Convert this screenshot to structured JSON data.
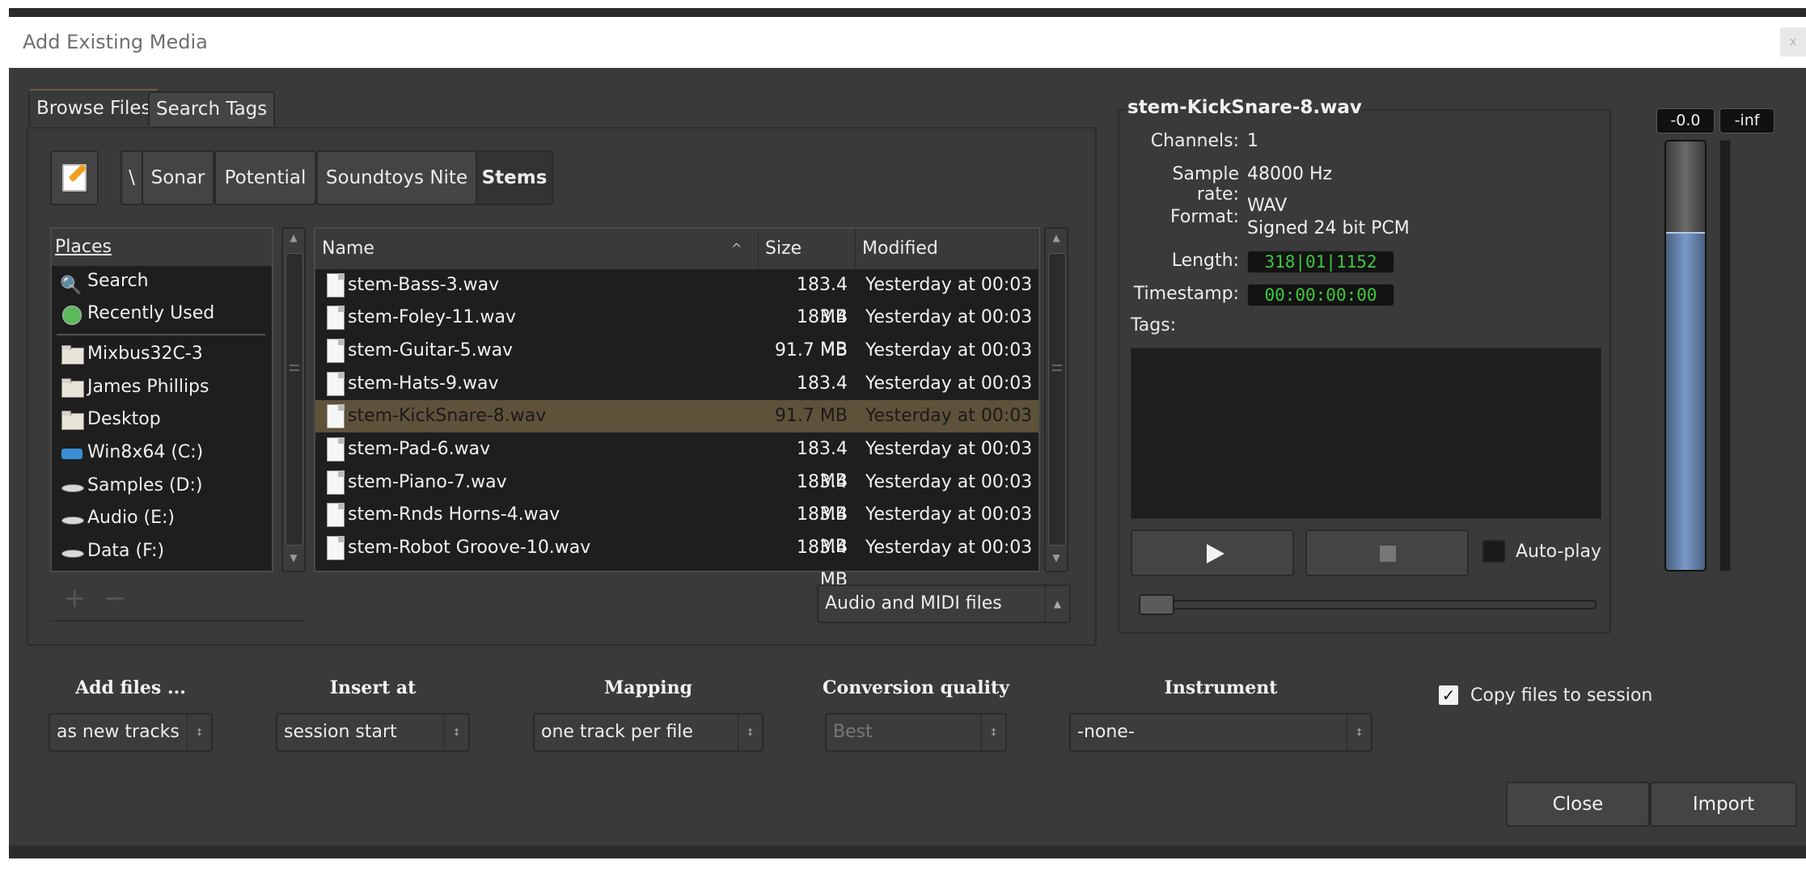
{
  "window": {
    "title": "Add Existing Media",
    "close_label": "x"
  },
  "tabs": [
    {
      "label": "Browse Files",
      "active": true
    },
    {
      "label": "Search Tags",
      "active": false
    }
  ],
  "path_bar": {
    "edit_icon": "edit-location-icon",
    "crumbs": [
      "\\",
      "Sonar",
      "Potential",
      "Soundtoys Nite",
      "Stems"
    ]
  },
  "places": {
    "header": "Places",
    "items": [
      {
        "label": "Search",
        "icon": "magnifier-icon"
      },
      {
        "label": "Recently Used",
        "icon": "recent-icon"
      },
      {
        "label": "Mixbus32C-3",
        "icon": "folder-icon"
      },
      {
        "label": "James Phillips",
        "icon": "folder-icon"
      },
      {
        "label": "Desktop",
        "icon": "folder-icon"
      },
      {
        "label": "Win8x64 (C:)",
        "icon": "windows-drive-icon"
      },
      {
        "label": "Samples (D:)",
        "icon": "drive-icon"
      },
      {
        "label": "Audio (E:)",
        "icon": "drive-icon"
      },
      {
        "label": "Data (F:)",
        "icon": "drive-icon"
      }
    ],
    "add_label": "+",
    "remove_label": "−"
  },
  "files": {
    "columns": {
      "name": "Name",
      "size": "Size",
      "modified": "Modified"
    },
    "sort_indicator": "^",
    "rows": [
      {
        "name": "stem-Bass-3.wav",
        "size": "183.4 MB",
        "modified": "Yesterday at 00:03",
        "selected": false
      },
      {
        "name": "stem-Foley-11.wav",
        "size": "183.4 MB",
        "modified": "Yesterday at 00:03",
        "selected": false
      },
      {
        "name": "stem-Guitar-5.wav",
        "size": "91.7 MB",
        "modified": "Yesterday at 00:03",
        "selected": false
      },
      {
        "name": "stem-Hats-9.wav",
        "size": "183.4 MB",
        "modified": "Yesterday at 00:03",
        "selected": false
      },
      {
        "name": "stem-KickSnare-8.wav",
        "size": "91.7 MB",
        "modified": "Yesterday at 00:03",
        "selected": true
      },
      {
        "name": "stem-Pad-6.wav",
        "size": "183.4 MB",
        "modified": "Yesterday at 00:03",
        "selected": false
      },
      {
        "name": "stem-Piano-7.wav",
        "size": "183.4 MB",
        "modified": "Yesterday at 00:03",
        "selected": false
      },
      {
        "name": "stem-Rnds Horns-4.wav",
        "size": "183.4 MB",
        "modified": "Yesterday at 00:03",
        "selected": false
      },
      {
        "name": "stem-Robot Groove-10.wav",
        "size": "183.4 MB",
        "modified": "Yesterday at 00:03",
        "selected": false
      }
    ],
    "filter": "Audio and MIDI files"
  },
  "info": {
    "file_title": "stem-KickSnare-8.wav",
    "channels_label": "Channels:",
    "channels": "1",
    "rate_label": "Sample rate:",
    "rate": "48000 Hz",
    "format_label": "Format:",
    "format_line1": "WAV",
    "format_line2": "Signed 24 bit PCM",
    "length_label": "Length:",
    "length": "318|01|1152",
    "timestamp_label": "Timestamp:",
    "timestamp": "00:00:00:00",
    "tags_label": "Tags:",
    "autoplay_label": "Auto-play",
    "seek_position": 0
  },
  "meters": {
    "peak_left": "-0.0",
    "peak_right": "-inf",
    "left_level": 0.79,
    "right_level": 0
  },
  "options": {
    "add_files": {
      "label": "Add files ...",
      "value": "as new tracks"
    },
    "insert_at": {
      "label": "Insert at",
      "value": "session start"
    },
    "mapping": {
      "label": "Mapping",
      "value": "one track per file"
    },
    "quality": {
      "label": "Conversion quality",
      "value": "Best"
    },
    "instrument": {
      "label": "Instrument",
      "value": "-none-"
    },
    "copy_files_label": "Copy files to session",
    "copy_checked": "✓"
  },
  "buttons": {
    "close": "Close",
    "import": "Import"
  },
  "colors": {
    "background": "#3a3a3a",
    "selection": "#5f523a",
    "clock_text": "#3ec93e",
    "meter_fill": "#7a9ac8"
  }
}
